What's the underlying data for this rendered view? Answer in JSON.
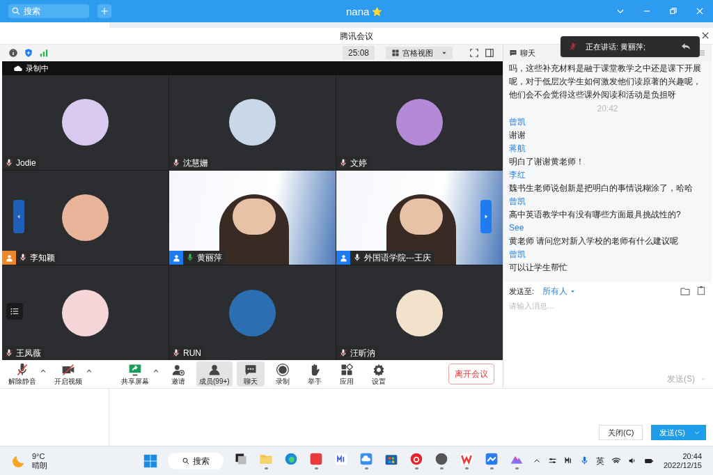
{
  "titlebar": {
    "search_placeholder": "搜索",
    "title": "nana",
    "star": "⭐"
  },
  "window": {
    "title": "腾讯会议"
  },
  "toolbar": {
    "timer": "25:08",
    "view": "宫格视图"
  },
  "recording": "录制中",
  "speaking_popup": {
    "text": "正在讲话: 黄丽萍;"
  },
  "participants": [
    {
      "name": "Jodie",
      "kind": "avatar",
      "muted": true
    },
    {
      "name": "沈慧姗",
      "kind": "avatar",
      "muted": true
    },
    {
      "name": "文婷",
      "kind": "avatar",
      "muted": true
    },
    {
      "name": "李知颖",
      "kind": "avatar",
      "muted": true,
      "color": "#f0862a"
    },
    {
      "name": "黄丽萍",
      "kind": "video",
      "muted": false,
      "speaking": true,
      "color": "#1e7cf0"
    },
    {
      "name": "外国语学院---王庆",
      "kind": "video",
      "muted": false,
      "speaking": false,
      "color": "#1e7cf0"
    },
    {
      "name": "王凤薇",
      "kind": "avatar",
      "muted": true
    },
    {
      "name": "RUN",
      "kind": "avatar",
      "muted": true
    },
    {
      "name": "汪昕汭",
      "kind": "avatar",
      "muted": true
    }
  ],
  "controls": [
    {
      "label": "解除静音",
      "kind": "mic",
      "caret": true,
      "selected": false
    },
    {
      "label": "开启视频",
      "kind": "video",
      "caret": true,
      "selected": false
    },
    {
      "label": "共享屏幕",
      "kind": "share",
      "caret": true,
      "selected": false
    },
    {
      "label": "邀请",
      "kind": "invite",
      "caret": false,
      "selected": false
    },
    {
      "label": "成员(99+)",
      "kind": "members",
      "caret": false,
      "selected": true
    },
    {
      "label": "聊天",
      "kind": "chat",
      "caret": false,
      "selected": true
    },
    {
      "label": "录制",
      "kind": "record",
      "caret": false,
      "selected": false
    },
    {
      "label": "举手",
      "kind": "hand",
      "caret": false,
      "selected": false
    },
    {
      "label": "应用",
      "kind": "apps",
      "caret": false,
      "selected": false
    },
    {
      "label": "设置",
      "kind": "settings",
      "caret": false,
      "selected": false
    }
  ],
  "leave_button": "离开会议",
  "chat": {
    "title": "聊天",
    "messages": [
      {
        "kind": "text",
        "text": "吗，这些补充材料是融于课堂教学之中还是课下开展呢，对于低层次学生如何激发他们读原著的兴趣呢，他们会不会觉得这些课外阅读和活动是负担呀"
      },
      {
        "kind": "time",
        "text": "20:42"
      },
      {
        "kind": "message",
        "sender": "曾凯",
        "text": "谢谢"
      },
      {
        "kind": "message",
        "sender": "蒋航",
        "text": "明白了谢谢黄老师！"
      },
      {
        "kind": "message",
        "sender": "李红",
        "text": "魏书生老师说创新是把明白的事情说糊涂了，哈哈"
      },
      {
        "kind": "message",
        "sender": "曾凯",
        "text": "高中英语教学中有没有哪些方面最具挑战性的?"
      },
      {
        "kind": "message",
        "sender": "See",
        "text": "黄老师 请问您对新入学校的老师有什么建议呢"
      },
      {
        "kind": "message",
        "sender": "曾凯",
        "text": "可以让学生帮忙"
      }
    ],
    "send_to_label": "发送至:",
    "send_to": "所有人",
    "placeholder": "请输入消息...",
    "send": "发送(S)"
  },
  "dialog_buttons": {
    "close": "关闭(C)",
    "send": "发送(S)"
  },
  "taskbar": {
    "temperature": "9°C",
    "weather": "晴朗",
    "search": "搜索",
    "apps": [
      {
        "kind": "taskview",
        "running": false
      },
      {
        "kind": "folder",
        "running": true
      },
      {
        "kind": "edge",
        "running": false
      },
      {
        "kind": "redapp",
        "running": true
      },
      {
        "kind": "mapp",
        "running": false
      },
      {
        "kind": "cloud",
        "running": true
      },
      {
        "kind": "store",
        "running": false
      },
      {
        "kind": "music",
        "running": true
      },
      {
        "kind": "avatar",
        "running": true
      },
      {
        "kind": "wps",
        "running": true
      },
      {
        "kind": "lark",
        "running": true
      },
      {
        "kind": "mountain",
        "running": true
      }
    ],
    "ime": "英",
    "time": "20:44",
    "date": "2022/12/15"
  }
}
